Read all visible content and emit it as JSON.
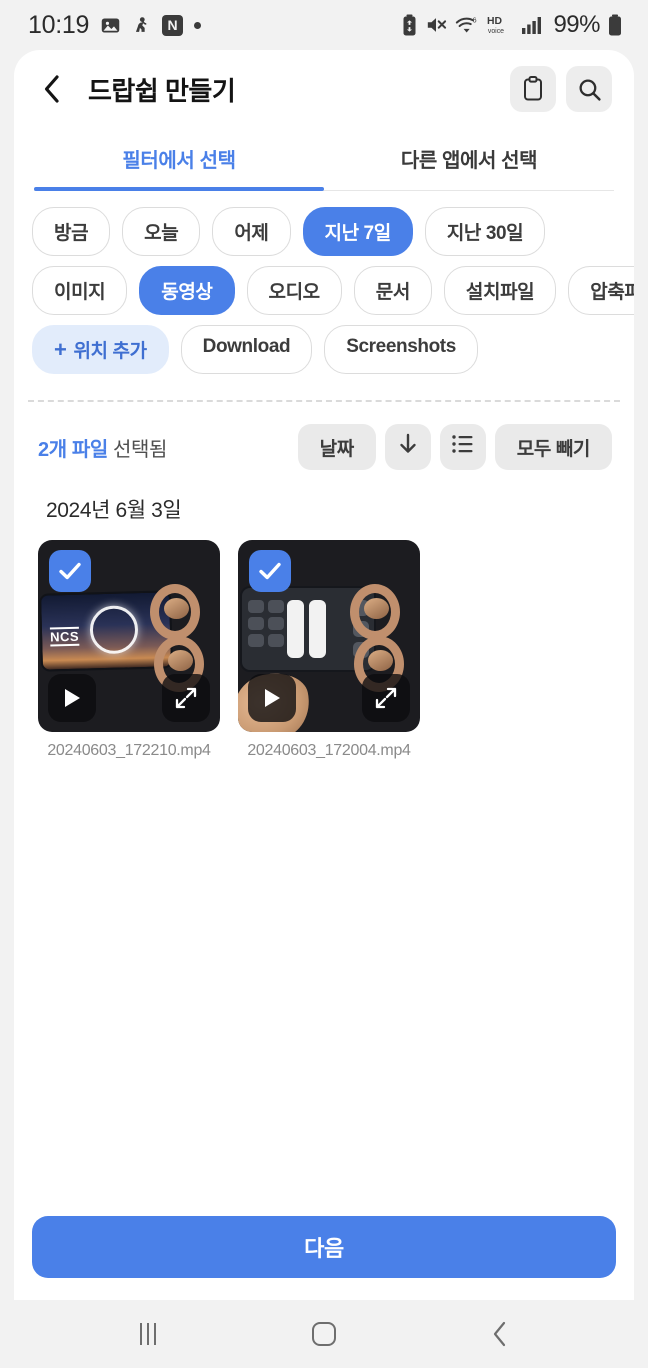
{
  "status_bar": {
    "time": "10:19",
    "left_icons": [
      "gallery-icon",
      "figure-icon",
      "naver-badge-icon",
      "dot-indicator"
    ],
    "naver_badge": "N",
    "right_icons": [
      "battery-saver-icon",
      "mute-icon",
      "wifi6-icon",
      "hd-voice-icon",
      "signal-bars-icon"
    ],
    "hd_label": "HD",
    "voice_label": "voice",
    "wifi_generation": "6",
    "battery_percent": "99%"
  },
  "header": {
    "back_icon": "chevron-left-icon",
    "title": "드랍쉽 만들기",
    "clipboard_icon": "clipboard-icon",
    "search_icon": "search-icon"
  },
  "tabs": [
    {
      "label": "필터에서 선택",
      "active": true
    },
    {
      "label": "다른 앱에서 선택",
      "active": false
    }
  ],
  "filters": {
    "rows": [
      [
        {
          "label": "방금",
          "selected": false
        },
        {
          "label": "오늘",
          "selected": false
        },
        {
          "label": "어제",
          "selected": false
        },
        {
          "label": "지난 7일",
          "selected": true
        },
        {
          "label": "지난 30일",
          "selected": false
        }
      ],
      [
        {
          "label": "이미지",
          "selected": false
        },
        {
          "label": "동영상",
          "selected": true
        },
        {
          "label": "오디오",
          "selected": false
        },
        {
          "label": "문서",
          "selected": false
        },
        {
          "label": "설치파일",
          "selected": false
        },
        {
          "label": "압축파일",
          "selected": false
        }
      ],
      [
        {
          "label": "위치 추가",
          "selected": false,
          "kind": "add"
        },
        {
          "label": "Download",
          "selected": false
        },
        {
          "label": "Screenshots",
          "selected": false
        }
      ]
    ]
  },
  "selection_bar": {
    "count_text": "2개 파일",
    "suffix_text": " 선택됨",
    "sort_label": "날짜",
    "sort_direction_icon": "arrow-down-icon",
    "view_mode_icon": "list-view-icon",
    "deselect_all_label": "모두 빼기"
  },
  "file_list": {
    "date_header": "2024년 6월 3일",
    "items": [
      {
        "name": "20240603_172210.mp4",
        "selected": true,
        "play_icon": "play-icon",
        "expand_icon": "expand-icon",
        "overlay_text": "NCS"
      },
      {
        "name": "20240603_172004.mp4",
        "selected": true,
        "play_icon": "play-icon",
        "expand_icon": "expand-icon"
      }
    ]
  },
  "cta": {
    "label": "다음"
  },
  "nav_bar": {
    "recents_icon": "recents-icon",
    "home_icon": "home-icon",
    "back_icon": "nav-back-icon"
  },
  "colors": {
    "accent": "#4a80e8",
    "accent_soft": "#e2ecfb",
    "page_bg": "#f2f2f2",
    "card_bg": "#ffffff",
    "pill_bg": "#eaeaea"
  }
}
